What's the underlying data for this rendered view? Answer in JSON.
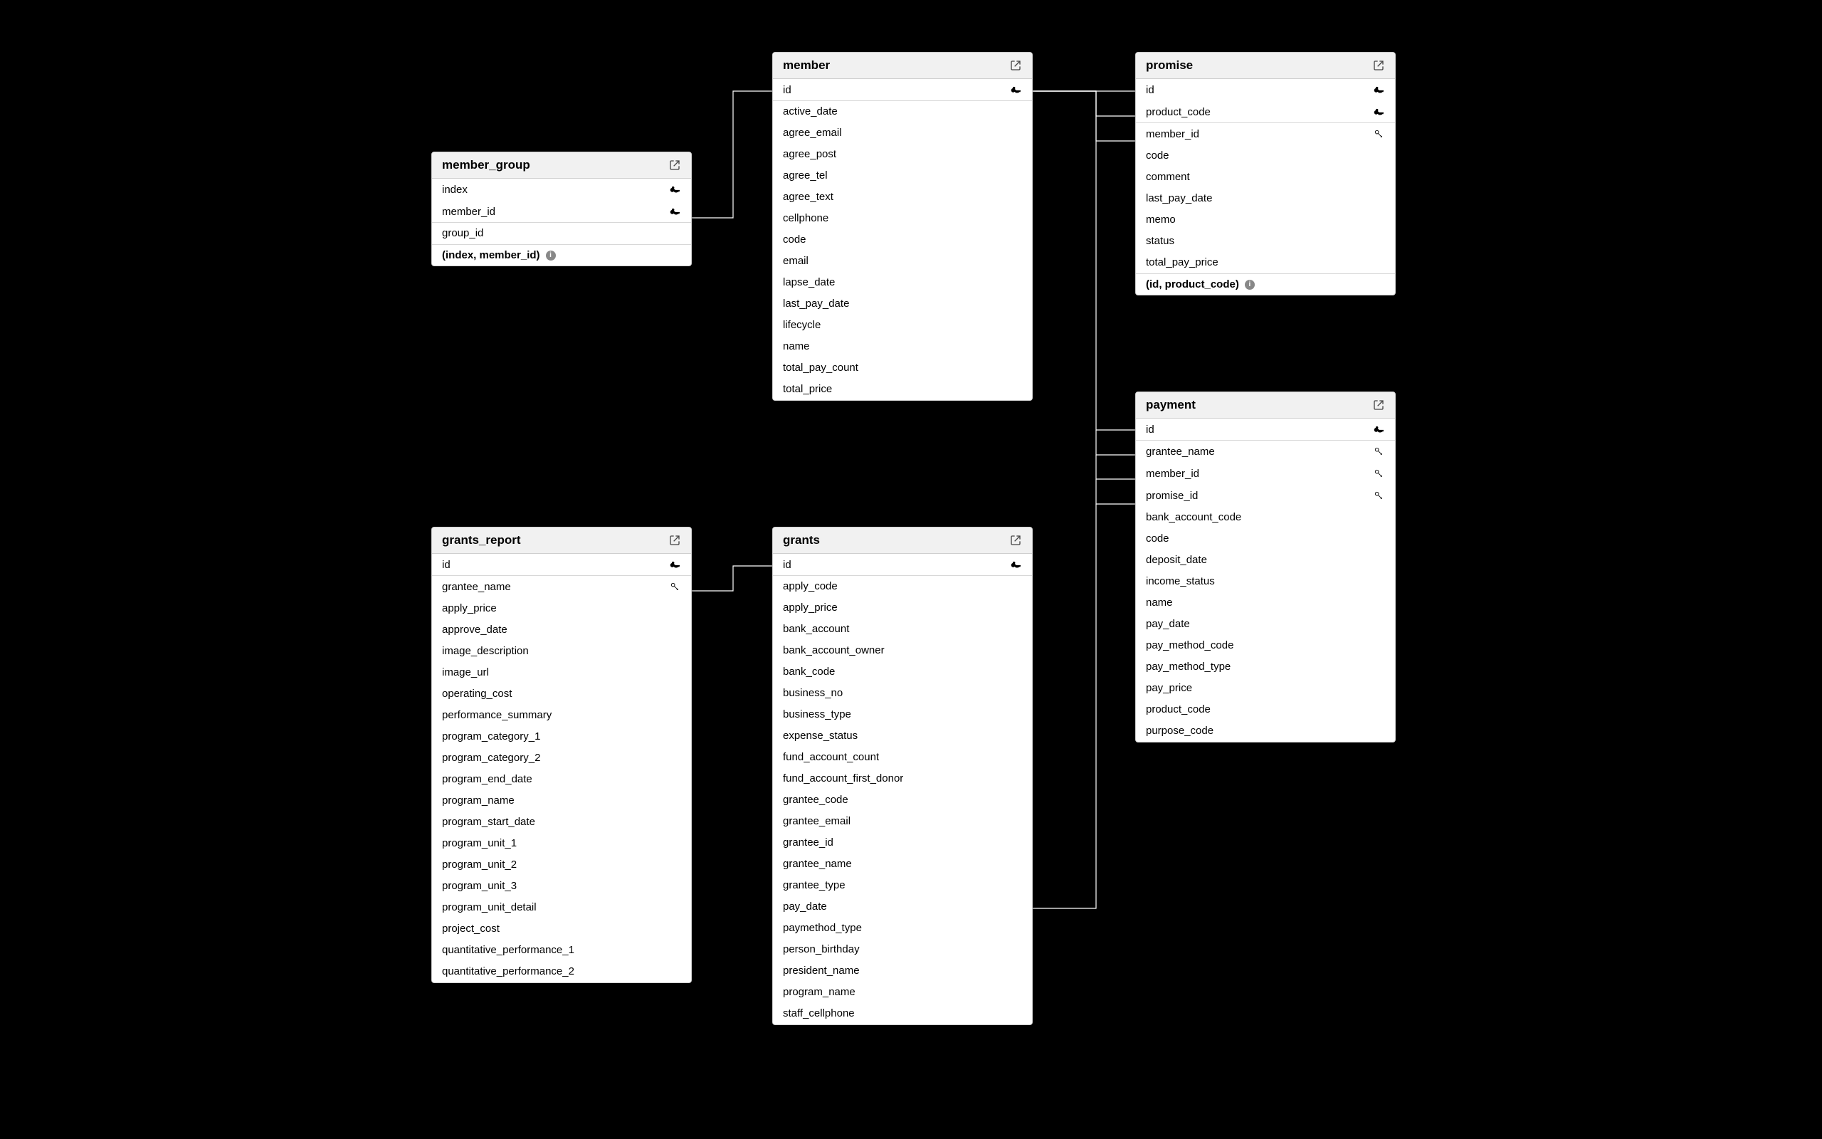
{
  "tables": {
    "member_group": {
      "title": "member_group",
      "columns": [
        {
          "name": "index",
          "icon": "pk"
        },
        {
          "name": "member_id",
          "icon": "pk",
          "sep": true
        },
        {
          "name": "group_id",
          "icon": null
        }
      ],
      "constraint": "(index, member_id)"
    },
    "member": {
      "title": "member",
      "columns": [
        {
          "name": "id",
          "icon": "pk",
          "sep": true
        },
        {
          "name": "active_date"
        },
        {
          "name": "agree_email"
        },
        {
          "name": "agree_post"
        },
        {
          "name": "agree_tel"
        },
        {
          "name": "agree_text"
        },
        {
          "name": "cellphone"
        },
        {
          "name": "code"
        },
        {
          "name": "email"
        },
        {
          "name": "lapse_date"
        },
        {
          "name": "last_pay_date"
        },
        {
          "name": "lifecycle"
        },
        {
          "name": "name"
        },
        {
          "name": "total_pay_count"
        },
        {
          "name": "total_price"
        }
      ]
    },
    "promise": {
      "title": "promise",
      "columns": [
        {
          "name": "id",
          "icon": "pk"
        },
        {
          "name": "product_code",
          "icon": "pk",
          "sep": true
        },
        {
          "name": "member_id",
          "icon": "fk"
        },
        {
          "name": "code"
        },
        {
          "name": "comment"
        },
        {
          "name": "last_pay_date"
        },
        {
          "name": "memo"
        },
        {
          "name": "status"
        },
        {
          "name": "total_pay_price"
        }
      ],
      "constraint": "(id, product_code)"
    },
    "payment": {
      "title": "payment",
      "columns": [
        {
          "name": "id",
          "icon": "pk",
          "sep": true
        },
        {
          "name": "grantee_name",
          "icon": "fk"
        },
        {
          "name": "member_id",
          "icon": "fk"
        },
        {
          "name": "promise_id",
          "icon": "fk"
        },
        {
          "name": "bank_account_code"
        },
        {
          "name": "code"
        },
        {
          "name": "deposit_date"
        },
        {
          "name": "income_status"
        },
        {
          "name": "name"
        },
        {
          "name": "pay_date"
        },
        {
          "name": "pay_method_code"
        },
        {
          "name": "pay_method_type"
        },
        {
          "name": "pay_price"
        },
        {
          "name": "product_code"
        },
        {
          "name": "purpose_code"
        }
      ]
    },
    "grants_report": {
      "title": "grants_report",
      "columns": [
        {
          "name": "id",
          "icon": "pk",
          "sep": true
        },
        {
          "name": "grantee_name",
          "icon": "fk"
        },
        {
          "name": "apply_price"
        },
        {
          "name": "approve_date"
        },
        {
          "name": "image_description"
        },
        {
          "name": "image_url"
        },
        {
          "name": "operating_cost"
        },
        {
          "name": "performance_summary"
        },
        {
          "name": "program_category_1"
        },
        {
          "name": "program_category_2"
        },
        {
          "name": "program_end_date"
        },
        {
          "name": "program_name"
        },
        {
          "name": "program_start_date"
        },
        {
          "name": "program_unit_1"
        },
        {
          "name": "program_unit_2"
        },
        {
          "name": "program_unit_3"
        },
        {
          "name": "program_unit_detail"
        },
        {
          "name": "project_cost"
        },
        {
          "name": "quantitative_performance_1"
        },
        {
          "name": "quantitative_performance_2"
        }
      ]
    },
    "grants": {
      "title": "grants",
      "columns": [
        {
          "name": "id",
          "icon": "pk",
          "sep": true
        },
        {
          "name": "apply_code"
        },
        {
          "name": "apply_price"
        },
        {
          "name": "bank_account"
        },
        {
          "name": "bank_account_owner"
        },
        {
          "name": "bank_code"
        },
        {
          "name": "business_no"
        },
        {
          "name": "business_type"
        },
        {
          "name": "expense_status"
        },
        {
          "name": "fund_account_count"
        },
        {
          "name": "fund_account_first_donor"
        },
        {
          "name": "grantee_code"
        },
        {
          "name": "grantee_email"
        },
        {
          "name": "grantee_id"
        },
        {
          "name": "grantee_name"
        },
        {
          "name": "grantee_type"
        },
        {
          "name": "pay_date"
        },
        {
          "name": "paymethod_type"
        },
        {
          "name": "person_birthday"
        },
        {
          "name": "president_name"
        },
        {
          "name": "program_name"
        },
        {
          "name": "staff_cellphone"
        }
      ]
    }
  }
}
